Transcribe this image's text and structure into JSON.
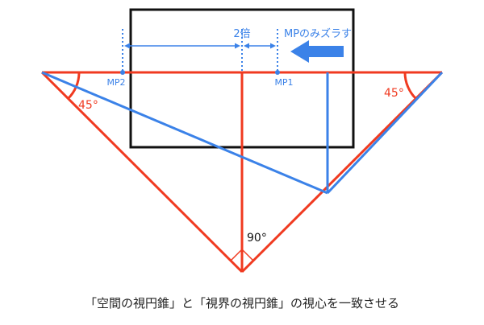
{
  "colors": {
    "red": "#f03a20",
    "blue": "#3b82e8",
    "black": "#111111",
    "text": "#222222"
  },
  "labels": {
    "mp2": "MP2",
    "mp1": "MP1",
    "scale": "2倍",
    "shift_note": "MPのみズラす",
    "angle_left": "45°",
    "angle_right": "45°",
    "angle_bottom": "90°"
  },
  "caption": "「空間の視円錐」と「視界の視円錐」の視心を一致させる",
  "icons": {
    "arrow": "arrow-left-icon",
    "right_angle": "right-angle-mark-icon"
  }
}
